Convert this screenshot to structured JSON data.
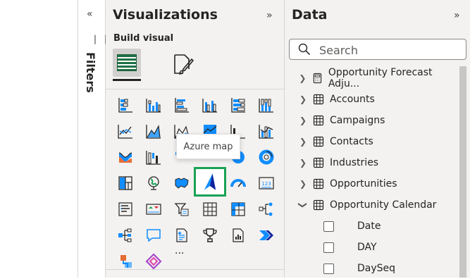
{
  "filters": {
    "label": "Filters",
    "collapse_icon": "«"
  },
  "visualizations": {
    "title": "Visualizations",
    "expand_icon": "»",
    "build_visual_label": "Build visual",
    "tooltip": "Azure map",
    "more": "..."
  },
  "data_pane": {
    "title": "Data",
    "expand_icon": "»",
    "search_placeholder": "Search",
    "items": [
      {
        "label": "Opportunity Forecast Adju...",
        "icon": "calculator-icon",
        "expanded": false
      },
      {
        "label": "Accounts",
        "icon": "table-icon",
        "expanded": false
      },
      {
        "label": "Campaigns",
        "icon": "table-icon",
        "expanded": false
      },
      {
        "label": "Contacts",
        "icon": "table-icon",
        "expanded": false
      },
      {
        "label": "Industries",
        "icon": "table-icon",
        "expanded": false
      },
      {
        "label": "Opportunities",
        "icon": "table-icon",
        "expanded": false
      },
      {
        "label": "Opportunity Calendar",
        "icon": "table-icon",
        "expanded": true
      }
    ],
    "fields": [
      {
        "label": "Date"
      },
      {
        "label": "DAY"
      },
      {
        "label": "DaySeq"
      }
    ]
  },
  "colors": {
    "accent_blue": "#118dff",
    "dark_blue": "#12239e",
    "selected_border": "#1aa255",
    "pane_bg": "#f3f2f1"
  }
}
